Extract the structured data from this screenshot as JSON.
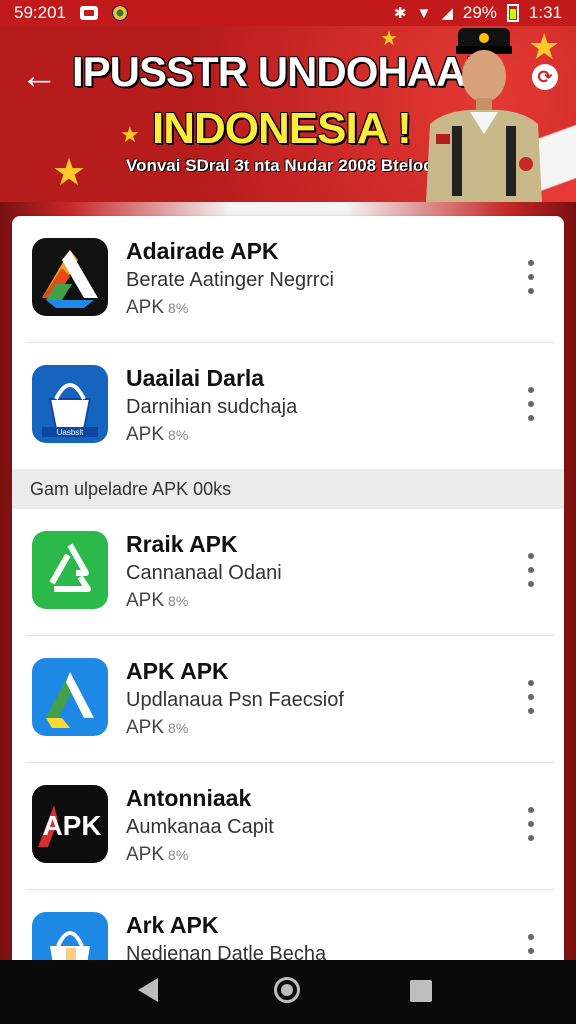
{
  "status_bar": {
    "time_left": "59:201",
    "battery_percent": "29%",
    "time_right": "1:31"
  },
  "banner": {
    "title_line1": "IPUSSTR UNDOHAAN",
    "title_line2": "INDONESIA !",
    "subtitle": "Vonvai SDral 3t nta Nudar 2008 Btelodel"
  },
  "apps": [
    {
      "name": "Adairade APK",
      "description": "Berate Aatinger Negrrci",
      "meta": "APK",
      "size": "8%",
      "icon": "drive-style-icon"
    },
    {
      "name": "Uaailai Darla",
      "description": "Darnihian sudchaja",
      "meta": "APK",
      "size": "8%",
      "icon": "bucket-icon"
    }
  ],
  "section_header": "Gam ulpeladre APK 00ks",
  "apps2": [
    {
      "name": "Rraik APK",
      "description": "Cannanaal Odani",
      "meta": "APK",
      "size": "8%",
      "icon": "recycle-icon"
    },
    {
      "name": "APK APK",
      "description": "Updlanaua Psn Faecsiof",
      "meta": "APK",
      "size": "8%",
      "icon": "triangle-icon"
    },
    {
      "name": "Antonniaak",
      "description": "Aumkanaa Capit",
      "meta": "APK",
      "size": "8%",
      "icon": "apk-logo-icon"
    },
    {
      "name": "Ark APK",
      "description": "Nedienan Datle Becha",
      "meta": "",
      "size": "",
      "icon": "bag-icon"
    }
  ],
  "colors": {
    "banner_red": "#b71c1c",
    "title_yellow": "#ffeb3b",
    "nav_bg": "#0a0a0a"
  }
}
